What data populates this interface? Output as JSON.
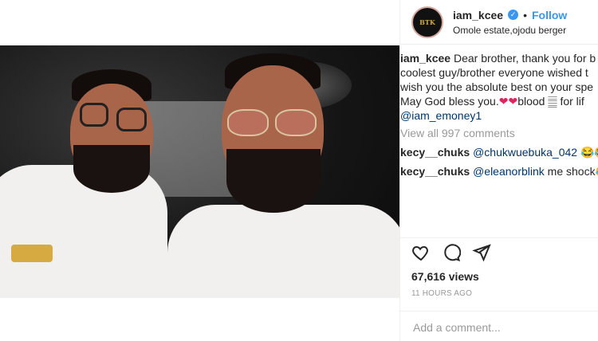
{
  "post": {
    "username": "iam_kcee",
    "follow_label": "Follow",
    "location": "Omole estate,ojodu berger",
    "avatar_text": "BTK",
    "caption": {
      "line1_user": "iam_kcee",
      "line1": "Dear brother, thank you for b",
      "line2": "coolest guy/brother everyone wished t",
      "line3": "wish you the absolute best on your spe",
      "line4_a": "May God bless you.",
      "line4_hearts": "❤❤",
      "line4_b": "blood",
      "line4_c": "for lif",
      "line5": "@iam_emoney1"
    },
    "view_all": "View all 997 comments",
    "comments": [
      {
        "user": "kecy__chuks",
        "mention": "@chukwuebuka_042",
        "text": " 😂😂"
      },
      {
        "user": "kecy__chuks",
        "mention": "@eleanorblink",
        "text": " me shock😂"
      }
    ],
    "likes": "67,616 views",
    "time": "11 HOURS AGO",
    "add_comment_placeholder": "Add a comment..."
  },
  "icons": {
    "like": "heart-icon",
    "comment": "comment-icon",
    "share": "share-icon",
    "verified": "verified-badge-icon"
  },
  "colors": {
    "accent": "#3897f0",
    "mention": "#003569",
    "muted": "#999999",
    "heart": "#e0245e"
  }
}
